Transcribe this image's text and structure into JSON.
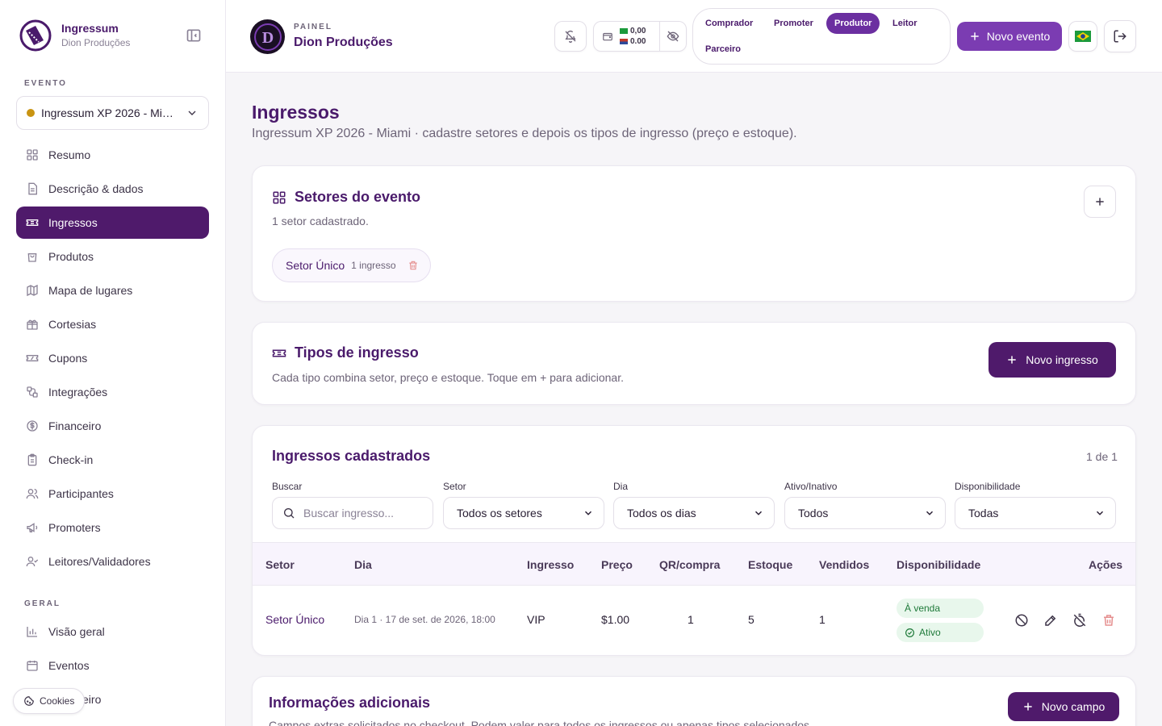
{
  "brand": {
    "name": "Ingressum",
    "sub": "Dion Produções"
  },
  "sidebar": {
    "event_label": "EVENTO",
    "event_selected": "Ingressum XP 2026 - Miami",
    "general_label": "GERAL",
    "items": [
      {
        "label": "Resumo",
        "icon": "grid-icon"
      },
      {
        "label": "Descrição & dados",
        "icon": "document-icon"
      },
      {
        "label": "Ingressos",
        "icon": "ticket-icon",
        "active": true
      },
      {
        "label": "Produtos",
        "icon": "bag-icon"
      },
      {
        "label": "Mapa de lugares",
        "icon": "map-icon"
      },
      {
        "label": "Cortesias",
        "icon": "gift-icon"
      },
      {
        "label": "Cupons",
        "icon": "coupon-icon"
      },
      {
        "label": "Integrações",
        "icon": "integration-icon"
      },
      {
        "label": "Financeiro",
        "icon": "dollar-icon"
      },
      {
        "label": "Check-in",
        "icon": "clipboard-icon"
      },
      {
        "label": "Participantes",
        "icon": "users-icon"
      },
      {
        "label": "Promoters",
        "icon": "megaphone-icon"
      },
      {
        "label": "Leitores/Validadores",
        "icon": "user-check-icon"
      }
    ],
    "general_items": [
      {
        "label": "Visão geral",
        "icon": "chart-icon"
      },
      {
        "label": "Eventos",
        "icon": "calendar-icon"
      },
      {
        "label": "Financeiro",
        "icon": "dollar-icon"
      }
    ],
    "cookies": "Cookies"
  },
  "header": {
    "kicker": "PAINEL",
    "title": "Dion Produções",
    "wallet_brl": "0,00",
    "wallet_usd": "0.00",
    "roles": [
      "Comprador",
      "Promoter",
      "Produtor",
      "Leitor",
      "Parceiro"
    ],
    "active_role": "Produtor",
    "new_event": "Novo evento"
  },
  "page": {
    "title": "Ingressos",
    "subtitle": "Ingressum XP 2026 - Miami · cadastre setores e depois os tipos de ingresso (preço e estoque)."
  },
  "sectors": {
    "title": "Setores do evento",
    "count_text": "1 setor cadastrado.",
    "chips": [
      {
        "name": "Setor Único",
        "count": "1 ingresso"
      }
    ]
  },
  "ticket_types": {
    "title": "Tipos de ingresso",
    "subtitle": "Cada tipo combina setor, preço e estoque. Toque em + para adicionar.",
    "button": "Novo ingresso"
  },
  "registered": {
    "title": "Ingressos cadastrados",
    "pagination": "1 de 1",
    "filters": {
      "search_label": "Buscar",
      "search_placeholder": "Buscar ingresso...",
      "sector_label": "Setor",
      "sector_value": "Todos os setores",
      "day_label": "Dia",
      "day_value": "Todos os dias",
      "active_label": "Ativo/Inativo",
      "active_value": "Todos",
      "avail_label": "Disponibilidade",
      "avail_value": "Todas"
    },
    "columns": [
      "Setor",
      "Dia",
      "Ingresso",
      "Preço",
      "QR/compra",
      "Estoque",
      "Vendidos",
      "Disponibilidade",
      "Ações"
    ],
    "rows": [
      {
        "sector": "Setor Único",
        "day": "Dia 1 · 17 de set. de 2026, 18:00",
        "ticket": "VIP",
        "price": "$1.00",
        "qr": "1",
        "stock": "5",
        "sold": "1",
        "badge1": "À venda",
        "badge2": "Ativo"
      }
    ]
  },
  "additional": {
    "title": "Informações adicionais",
    "subtitle": "Campos extras solicitados no checkout. Podem valer para todos os ingressos ou apenas tipos selecionados.",
    "button": "Novo campo"
  },
  "colors": {
    "primary": "#4f1a6b",
    "accent": "#7b3cb2",
    "status_green": "#1f7a3a",
    "danger": "#e58f8f"
  }
}
